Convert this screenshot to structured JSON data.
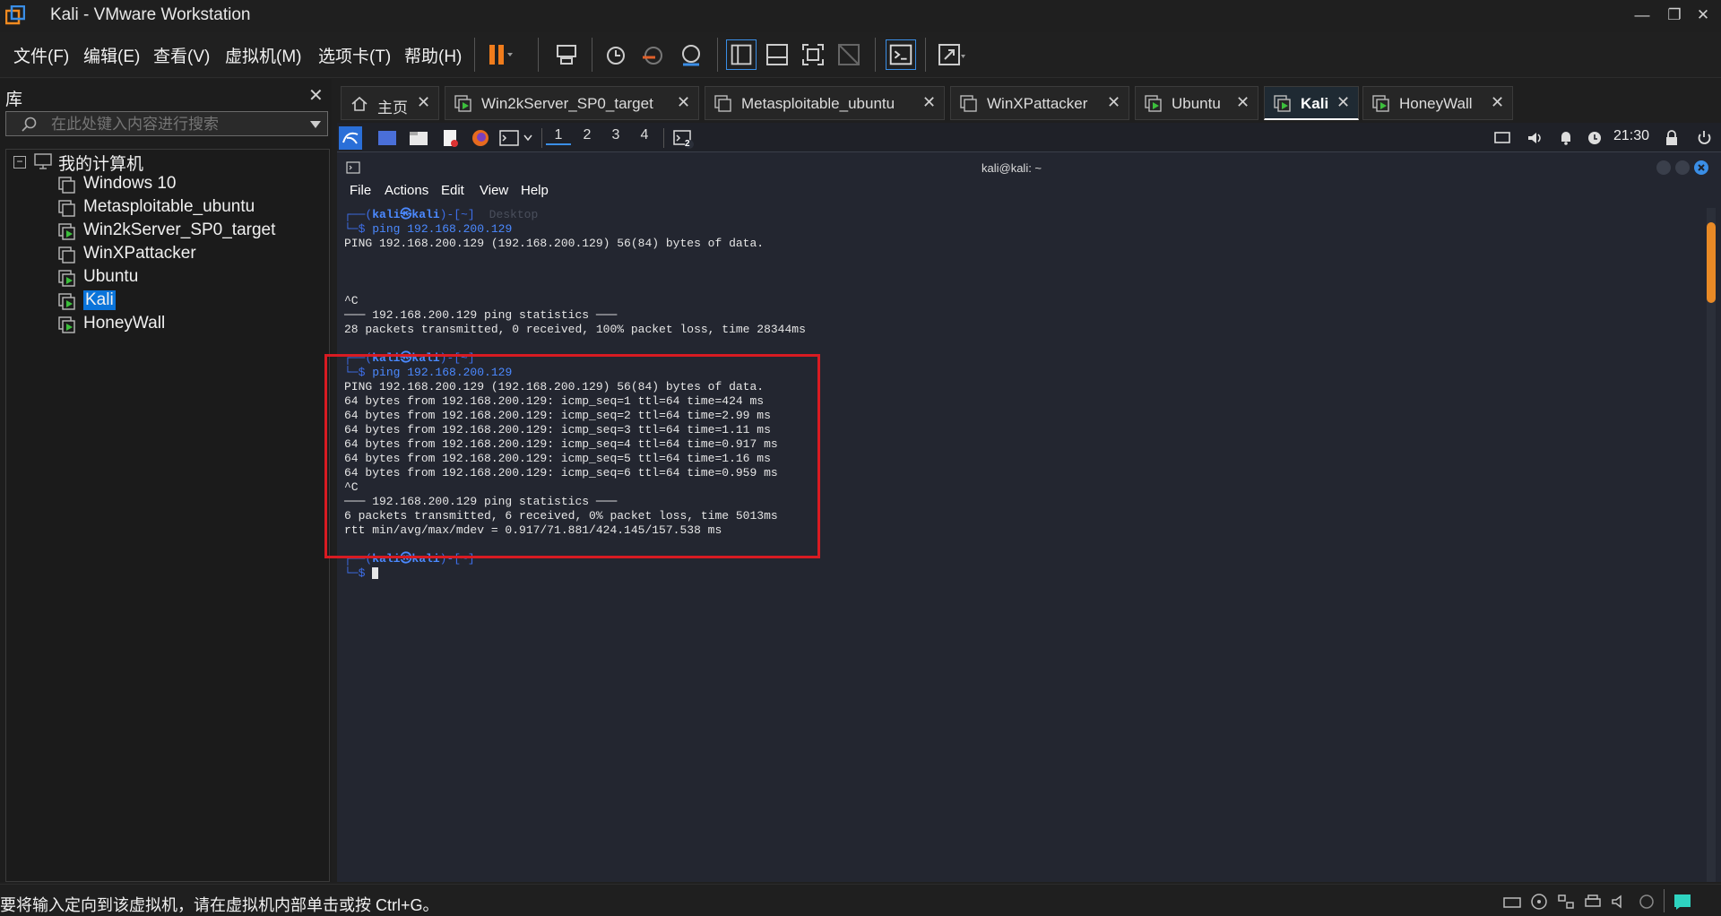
{
  "window": {
    "title": "Kali - VMware Workstation",
    "minimize": "—",
    "restore": "❐",
    "close": "✕"
  },
  "menu": {
    "items": [
      "文件(F)",
      "编辑(E)",
      "查看(V)",
      "虚拟机(M)",
      "选项卡(T)",
      "帮助(H)"
    ]
  },
  "library": {
    "title": "库",
    "close": "✕",
    "search_placeholder": "在此处键入内容进行搜索",
    "root": "我的计算机",
    "expander": "−",
    "vms": [
      {
        "name": "Windows 10",
        "running": false,
        "selected": false
      },
      {
        "name": "Metasploitable_ubuntu",
        "running": false,
        "selected": false
      },
      {
        "name": "Win2kServer_SP0_target",
        "running": true,
        "selected": false
      },
      {
        "name": "WinXPattacker",
        "running": false,
        "selected": false
      },
      {
        "name": "Ubuntu",
        "running": true,
        "selected": false
      },
      {
        "name": "Kali",
        "running": true,
        "selected": true
      },
      {
        "name": "HoneyWall",
        "running": true,
        "selected": false
      }
    ]
  },
  "tabs": [
    {
      "label": "主页",
      "icon": "home-icon",
      "active": false
    },
    {
      "label": "Win2kServer_SP0_target",
      "icon": "vm-running-icon",
      "active": false
    },
    {
      "label": "Metasploitable_ubuntu",
      "icon": "vm-icon",
      "active": false
    },
    {
      "label": "WinXPattacker",
      "icon": "vm-icon",
      "active": false
    },
    {
      "label": "Ubuntu",
      "icon": "vm-running-icon",
      "active": false
    },
    {
      "label": "Kali",
      "icon": "vm-running-icon",
      "active": true
    },
    {
      "label": "HoneyWall",
      "icon": "vm-running-icon",
      "active": false
    }
  ],
  "guest_panel": {
    "workspaces": [
      "1",
      "2",
      "3",
      "4"
    ],
    "terminal_badge": "2",
    "clock": "21:30"
  },
  "terminal": {
    "title": "kali@kali: ~",
    "menu": [
      "File",
      "Actions",
      "Edit",
      "View",
      "Help"
    ],
    "ghost_text": "Desktop",
    "blocks": [
      {
        "prompt_frame": "┌──(",
        "user": "kali㉿kali",
        "prompt_path": ")-[~]",
        "prompt_end": "└─$",
        "command": "ping 192.168.200.129",
        "output": [
          "PING 192.168.200.129 (192.168.200.129) 56(84) bytes of data.",
          "",
          "",
          "",
          "^C",
          "─── 192.168.200.129 ping statistics ───",
          "28 packets transmitted, 0 received, 100% packet loss, time 28344ms",
          ""
        ]
      },
      {
        "prompt_frame": "┌──(",
        "user": "kali㉿kali",
        "prompt_path": ")-[~]",
        "prompt_end": "└─$",
        "command": "ping 192.168.200.129",
        "output": [
          "PING 192.168.200.129 (192.168.200.129) 56(84) bytes of data.",
          "64 bytes from 192.168.200.129: icmp_seq=1 ttl=64 time=424 ms",
          "64 bytes from 192.168.200.129: icmp_seq=2 ttl=64 time=2.99 ms",
          "64 bytes from 192.168.200.129: icmp_seq=3 ttl=64 time=1.11 ms",
          "64 bytes from 192.168.200.129: icmp_seq=4 ttl=64 time=0.917 ms",
          "64 bytes from 192.168.200.129: icmp_seq=5 ttl=64 time=1.16 ms",
          "64 bytes from 192.168.200.129: icmp_seq=6 ttl=64 time=0.959 ms",
          "^C",
          "─── 192.168.200.129 ping statistics ───",
          "6 packets transmitted, 6 received, 0% packet loss, time 5013ms",
          "rtt min/avg/max/mdev = 0.917/71.881/424.145/157.538 ms",
          ""
        ]
      },
      {
        "prompt_frame": "┌──(",
        "user": "kali㉿kali",
        "prompt_path": ")-[~]",
        "prompt_end": "└─$",
        "command": "",
        "output": []
      }
    ]
  },
  "status": {
    "message": "要将输入定向到该虚拟机，请在虚拟机内部单击或按 Ctrl+G。"
  },
  "colors": {
    "accent": "#0a74da",
    "highlight_box": "#d81b22",
    "pause_orange": "#f07c1c",
    "prompt_blue": "#4b89ff"
  }
}
